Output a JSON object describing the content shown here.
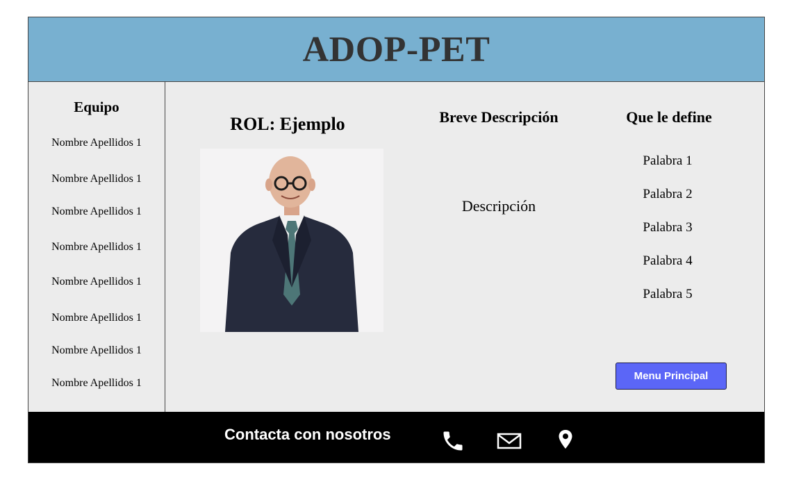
{
  "header": {
    "title": "ADOP-PET"
  },
  "sidebar": {
    "title": "Equipo",
    "members": [
      "Nombre Apellidos 1",
      "Nombre Apellidos 1",
      "Nombre Apellidos 1",
      "Nombre Apellidos 1",
      "Nombre Apellidos 1",
      "Nombre Apellidos 1",
      "Nombre Apellidos 1",
      "Nombre Apellidos 1"
    ]
  },
  "main": {
    "role_title": "ROL: Ejemplo",
    "description_title": "Breve Descripción",
    "description_text": "Descripción",
    "define_title": "Que le define",
    "words": [
      "Palabra 1",
      "Palabra 2",
      "Palabra 3",
      "Palabra 4",
      "Palabra 5"
    ],
    "menu_button": "Menu Principal"
  },
  "footer": {
    "contact_text": "Contacta con nosotros",
    "icons": [
      "phone-icon",
      "mail-icon",
      "location-pin-icon"
    ]
  },
  "colors": {
    "header_bg": "#78b0d0",
    "content_bg": "#ececec",
    "button_bg": "#5b66f7",
    "footer_bg": "#000000"
  }
}
